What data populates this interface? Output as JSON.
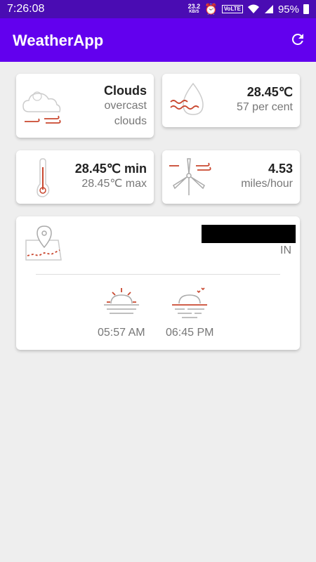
{
  "status": {
    "time": "7:26:08",
    "speed_value": "23.2",
    "speed_unit": "KB/S",
    "network": "VoLTE",
    "battery": "95%"
  },
  "appbar": {
    "title": "WeatherApp",
    "refresh_icon": "refresh-icon"
  },
  "condition": {
    "main": "Clouds",
    "description_line1": "overcast",
    "description_line2": "clouds",
    "icon": "cloud-wind-icon"
  },
  "humidity": {
    "temp": "28.45℃",
    "value": "57 per cent",
    "icon": "water-drop-icon"
  },
  "temperature": {
    "min": "28.45℃ min",
    "max": "28.45℃ max",
    "icon": "thermometer-icon"
  },
  "wind": {
    "speed": "4.53",
    "unit": "miles/hour",
    "icon": "wind-turbine-icon"
  },
  "location": {
    "country": "IN",
    "icon": "map-pin-icon"
  },
  "sun": {
    "sunrise": "05:57 AM",
    "sunset": "06:45 PM"
  },
  "colors": {
    "statusbar": "#4a0cb3",
    "appbar": "#6200ee",
    "accent_icon": "#c9472f"
  }
}
